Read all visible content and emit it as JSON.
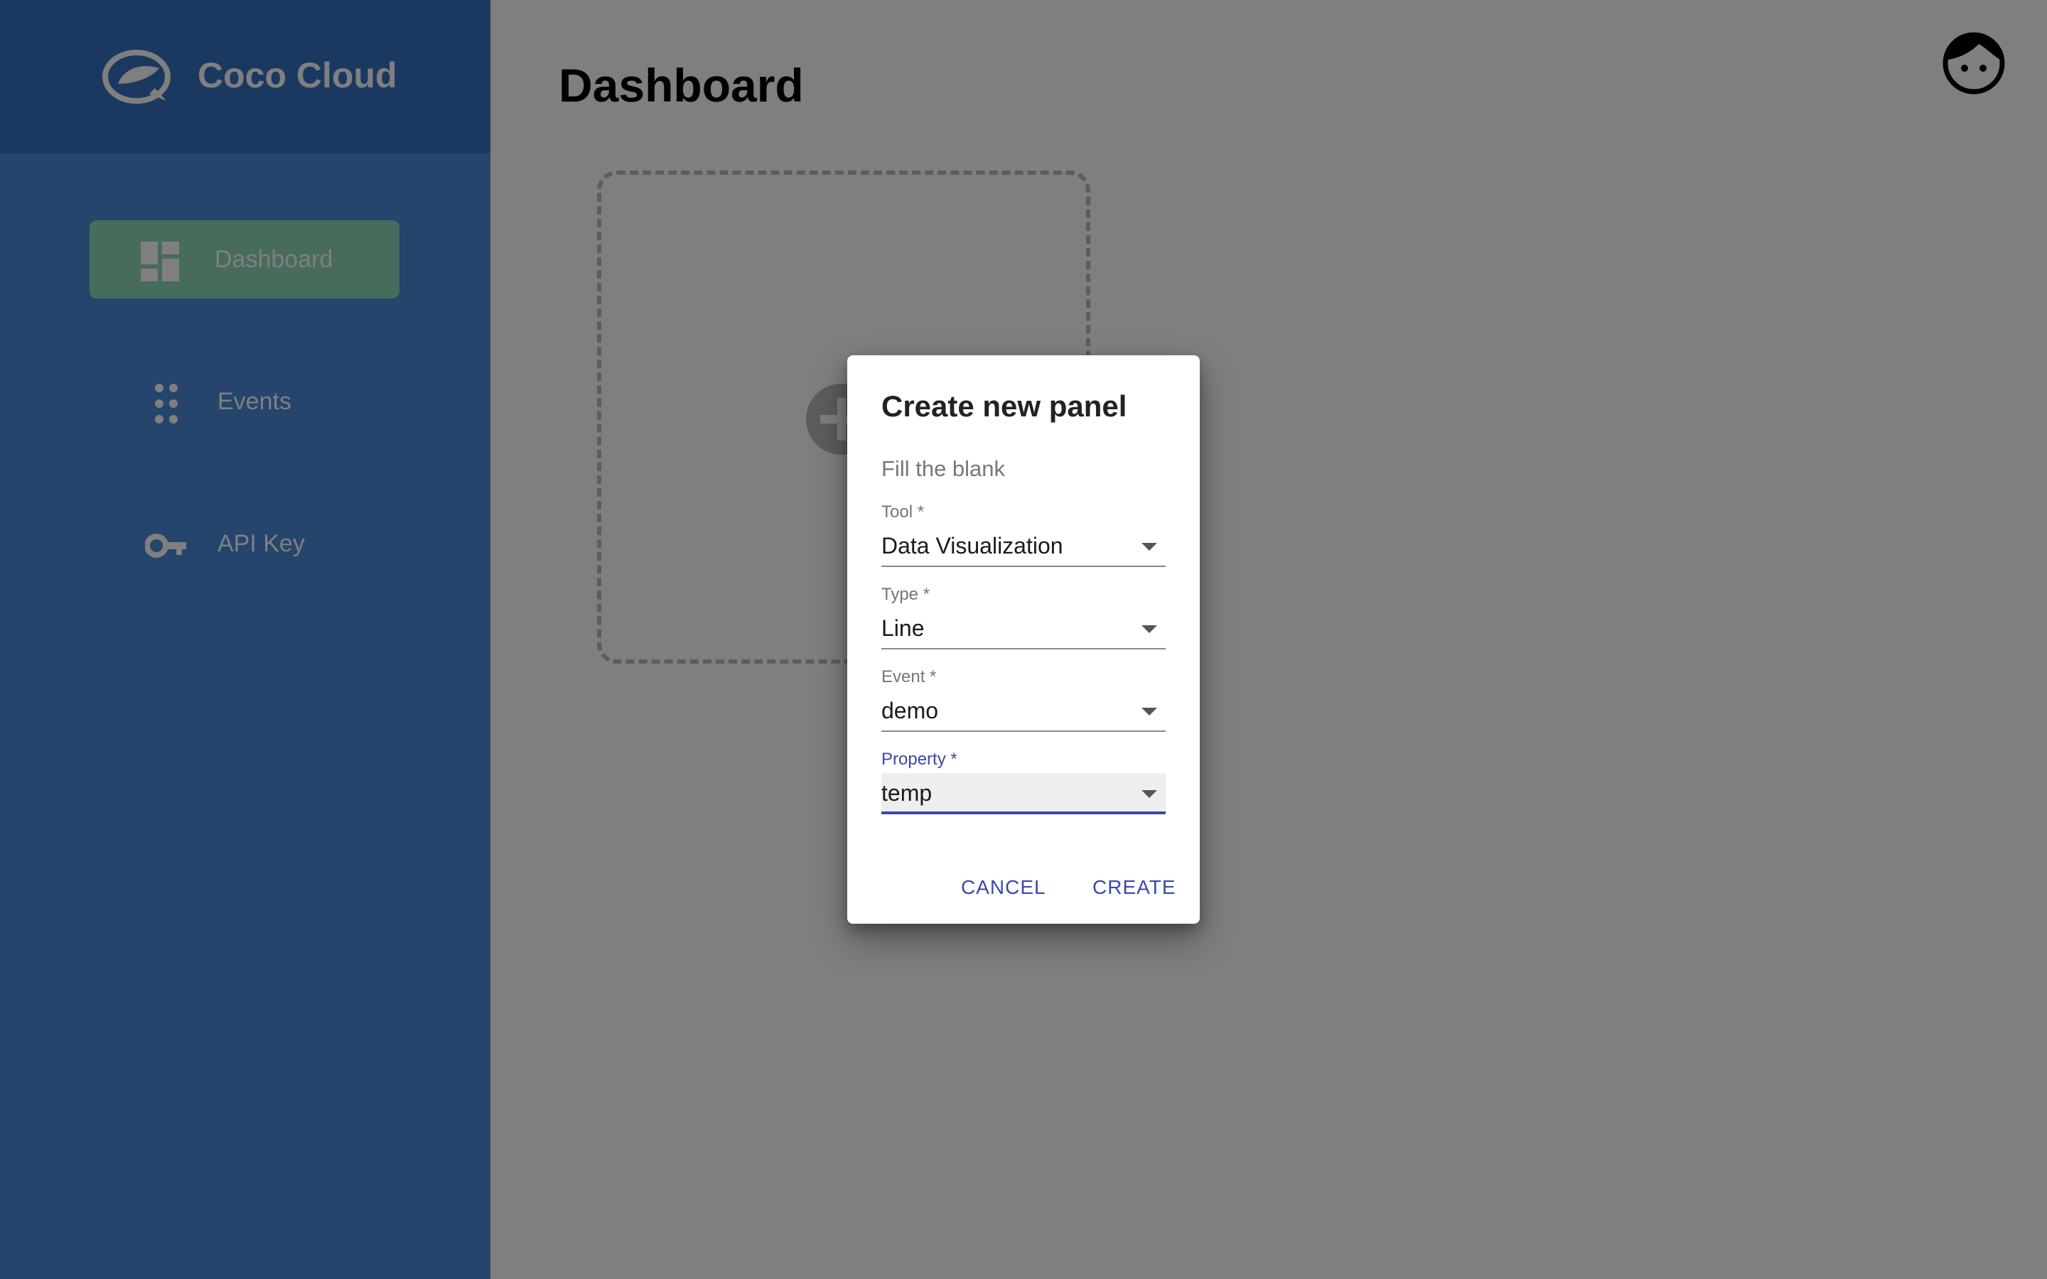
{
  "sidebar": {
    "brand": "Coco Cloud",
    "items": [
      {
        "label": "Dashboard",
        "icon": "dashboard-icon",
        "active": true
      },
      {
        "label": "Events",
        "icon": "dots-grid-icon",
        "active": false
      },
      {
        "label": "API Key",
        "icon": "key-icon",
        "active": false
      }
    ]
  },
  "main": {
    "title": "Dashboard",
    "add_panel_icon": "plus-circle-icon",
    "avatar_icon": "face-avatar-icon"
  },
  "dialog": {
    "title": "Create new panel",
    "subtitle": "Fill the blank",
    "fields": [
      {
        "label": "Tool *",
        "value": "Data Visualization"
      },
      {
        "label": "Type *",
        "value": "Line"
      },
      {
        "label": "Event *",
        "value": "demo"
      },
      {
        "label": "Property *",
        "value": "temp",
        "focused": true
      }
    ],
    "cancel_label": "CANCEL",
    "create_label": "CREATE"
  },
  "colors": {
    "sidebar": "#4a8bdb",
    "sidebar_header": "#3673c0",
    "active_item": "#8fd9b6",
    "accent": "#3949ab"
  }
}
